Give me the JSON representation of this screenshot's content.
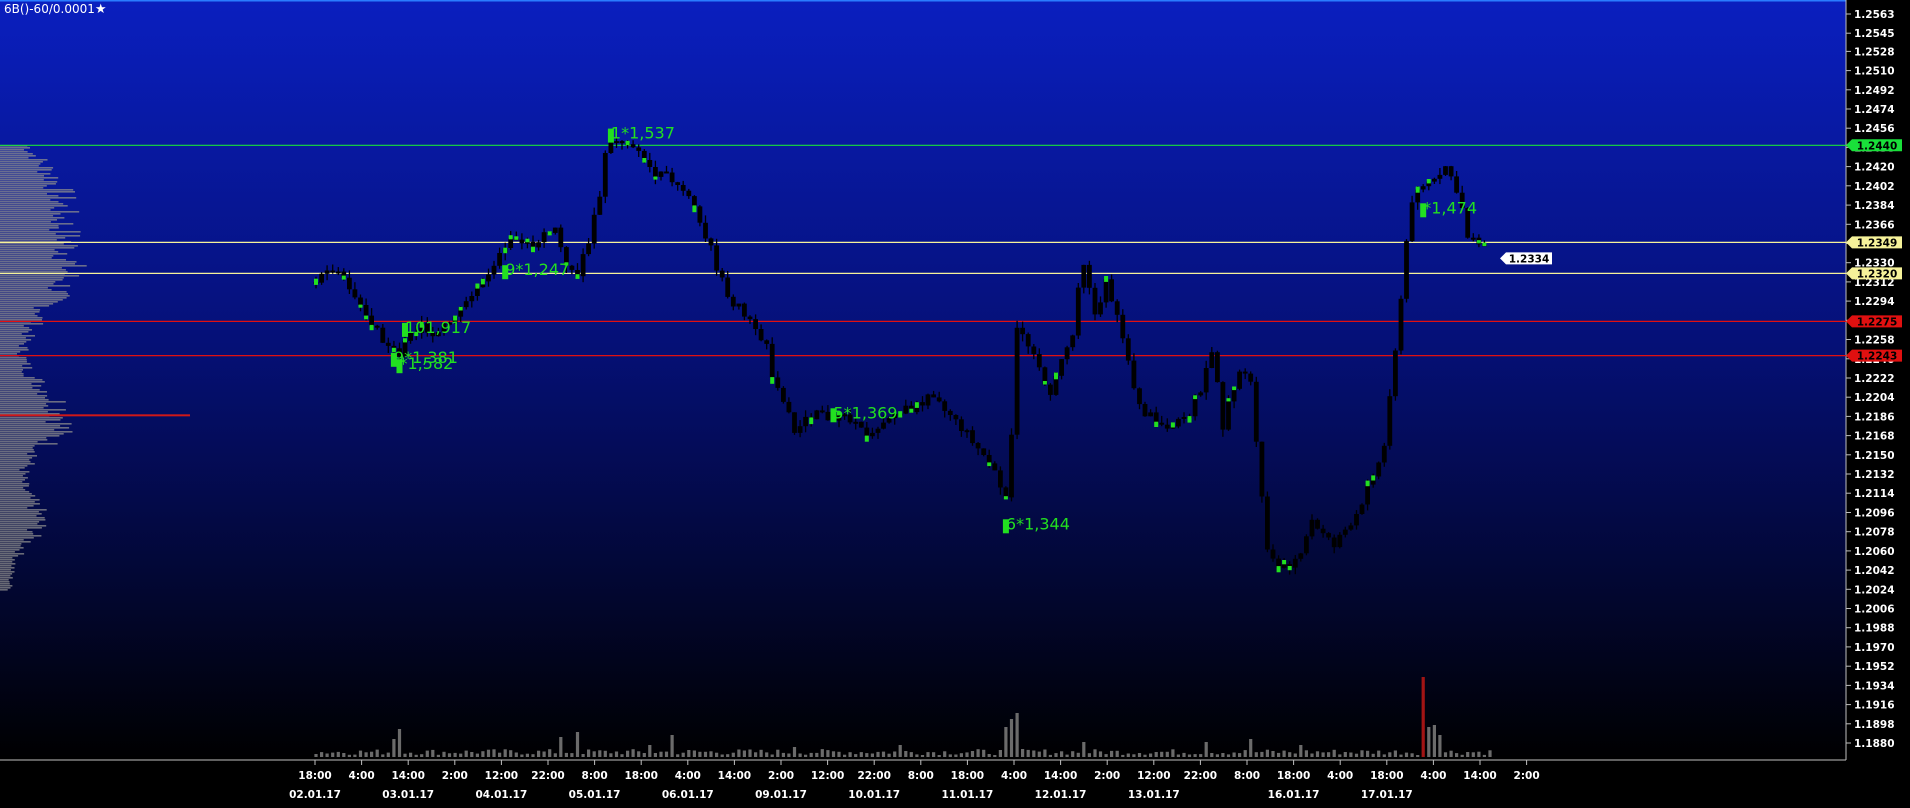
{
  "header": {
    "title": "6B()-60/0.0001",
    "star_icon": "star-icon"
  },
  "colors": {
    "bg_top": "#0a1fbf",
    "bg_bottom": "#000000",
    "candle": "#000000",
    "cluster": "#22e020",
    "profile": "#8c8c8c",
    "poc": "#d01818",
    "volume": "#6b6b6b",
    "volume_peak": "#a11414",
    "level_green": "#19e03a",
    "level_yellow": "#f6f29a",
    "level_red": "#e01010",
    "axis_text": "#ffffff"
  },
  "chart_data": {
    "type": "line",
    "title": "6B()-60/0.0001",
    "ylim": [
      1.187,
      1.257
    ],
    "yticks": [
      1.188,
      1.1898,
      1.1916,
      1.1934,
      1.1952,
      1.197,
      1.1988,
      1.2006,
      1.2024,
      1.2042,
      1.206,
      1.2078,
      1.2096,
      1.2114,
      1.2132,
      1.215,
      1.2168,
      1.2186,
      1.2204,
      1.2222,
      1.224,
      1.2258,
      1.2276,
      1.2294,
      1.2312,
      1.233,
      1.2348,
      1.2366,
      1.2384,
      1.2402,
      1.242,
      1.2438,
      1.2456,
      1.2474,
      1.2492,
      1.251,
      1.2528,
      1.2545,
      1.2563
    ],
    "x_time_labels": [
      "18:00",
      "4:00",
      "14:00",
      "2:00",
      "12:00",
      "22:00",
      "8:00",
      "18:00",
      "4:00",
      "14:00",
      "2:00",
      "12:00",
      "22:00",
      "8:00",
      "18:00",
      "4:00",
      "14:00",
      "2:00",
      "12:00",
      "22:00",
      "8:00",
      "18:00",
      "4:00",
      "18:00",
      "4:00",
      "14:00",
      "2:00"
    ],
    "x_date_labels": [
      "02.01.17",
      "03.01.17",
      "04.01.17",
      "05.01.17",
      "06.01.17",
      "09.01.17",
      "10.01.17",
      "11.01.17",
      "12.01.17",
      "13.01.17",
      "16.01.17",
      "17.01.17"
    ],
    "series": [
      {
        "values": [
          [
            0,
            1.2312
          ],
          [
            3,
            1.2322
          ],
          [
            5,
            1.232
          ],
          [
            7,
            1.23
          ],
          [
            9,
            1.2278
          ],
          [
            11,
            1.2268
          ],
          [
            13,
            1.225
          ],
          [
            15,
            1.2242
          ],
          [
            17,
            1.2262
          ],
          [
            19,
            1.227
          ],
          [
            21,
            1.2258
          ],
          [
            23,
            1.2268
          ],
          [
            25,
            1.2282
          ],
          [
            27,
            1.2298
          ],
          [
            29,
            1.2308
          ],
          [
            31,
            1.2322
          ],
          [
            33,
            1.2335
          ],
          [
            35,
            1.2348
          ],
          [
            37,
            1.2352
          ],
          [
            39,
            1.2348
          ],
          [
            41,
            1.2358
          ],
          [
            43,
            1.2362
          ],
          [
            45,
            1.233
          ],
          [
            47,
            1.2318
          ],
          [
            49,
            1.2352
          ],
          [
            51,
            1.2395
          ],
          [
            52,
            1.2432
          ],
          [
            53,
            1.2445
          ],
          [
            55,
            1.244
          ],
          [
            57,
            1.2436
          ],
          [
            59,
            1.2425
          ],
          [
            61,
            1.2415
          ],
          [
            63,
            1.241
          ],
          [
            65,
            1.2405
          ],
          [
            67,
            1.2395
          ],
          [
            69,
            1.2368
          ],
          [
            71,
            1.2342
          ],
          [
            73,
            1.2312
          ],
          [
            75,
            1.2292
          ],
          [
            77,
            1.2282
          ],
          [
            79,
            1.2272
          ],
          [
            81,
            1.2252
          ],
          [
            82,
            1.2218
          ],
          [
            84,
            1.22
          ],
          [
            86,
            1.2172
          ],
          [
            88,
            1.2182
          ],
          [
            90,
            1.219
          ],
          [
            92,
            1.2185
          ],
          [
            94,
            1.2186
          ],
          [
            96,
            1.218
          ],
          [
            98,
            1.2172
          ],
          [
            100,
            1.2168
          ],
          [
            102,
            1.2176
          ],
          [
            104,
            1.2188
          ],
          [
            106,
            1.2192
          ],
          [
            108,
            1.2195
          ],
          [
            110,
            1.2202
          ],
          [
            112,
            1.2196
          ],
          [
            114,
            1.2186
          ],
          [
            116,
            1.2176
          ],
          [
            118,
            1.2162
          ],
          [
            120,
            1.215
          ],
          [
            122,
            1.2132
          ],
          [
            124,
            1.2114
          ],
          [
            125,
            1.2172
          ],
          [
            126,
            1.2272
          ],
          [
            128,
            1.225
          ],
          [
            130,
            1.223
          ],
          [
            132,
            1.221
          ],
          [
            134,
            1.2238
          ],
          [
            136,
            1.2262
          ],
          [
            137,
            1.2302
          ],
          [
            138,
            1.2325
          ],
          [
            140,
            1.2282
          ],
          [
            142,
            1.2312
          ],
          [
            144,
            1.2285
          ],
          [
            145,
            1.2258
          ],
          [
            147,
            1.221
          ],
          [
            149,
            1.219
          ],
          [
            151,
            1.2182
          ],
          [
            153,
            1.2178
          ],
          [
            155,
            1.2185
          ],
          [
            157,
            1.219
          ],
          [
            159,
            1.2212
          ],
          [
            161,
            1.2242
          ],
          [
            162,
            1.2215
          ],
          [
            163,
            1.2172
          ],
          [
            164,
            1.2205
          ],
          [
            166,
            1.2228
          ],
          [
            168,
            1.222
          ],
          [
            171,
            1.206
          ],
          [
            173,
            1.2048
          ],
          [
            175,
            1.204
          ],
          [
            177,
            1.2062
          ],
          [
            179,
            1.209
          ],
          [
            181,
            1.2075
          ],
          [
            183,
            1.2064
          ],
          [
            185,
            1.208
          ],
          [
            187,
            1.2096
          ],
          [
            189,
            1.2118
          ],
          [
            191,
            1.2142
          ],
          [
            192,
            1.216
          ],
          [
            193,
            1.22
          ],
          [
            194,
            1.2245
          ],
          [
            195,
            1.23
          ],
          [
            196,
            1.235
          ],
          [
            197,
            1.239
          ],
          [
            199,
            1.2398
          ],
          [
            201,
            1.2412
          ],
          [
            203,
            1.242
          ],
          [
            205,
            1.24
          ],
          [
            206,
            1.238
          ],
          [
            207,
            1.2352
          ],
          [
            209,
            1.2348
          ],
          [
            211,
            1.234
          ]
        ]
      }
    ],
    "level_lines": [
      {
        "value": 1.244,
        "label": "1.2440",
        "color": "green"
      },
      {
        "value": 1.2349,
        "label": "1.2349",
        "color": "yellow"
      },
      {
        "value": 1.232,
        "label": "1.2320",
        "color": "yellow"
      },
      {
        "value": 1.2275,
        "label": "1.2275",
        "color": "red"
      },
      {
        "value": 1.2243,
        "label": "1.2243",
        "color": "red"
      }
    ],
    "current_price": {
      "value": 1.2334,
      "label": "1.2334"
    },
    "annotations": [
      {
        "text": "1*1,537",
        "x": 53,
        "y": 1.245
      },
      {
        "text": "9*1,247",
        "x": 34,
        "y": 1.2322
      },
      {
        "text": "101,917",
        "x": 16,
        "y": 1.2268
      },
      {
        "text": "9*1,381",
        "x": 14,
        "y": 1.224
      },
      {
        "text": "*1,582",
        "x": 15,
        "y": 1.2234
      },
      {
        "text": "5*1,369",
        "x": 93,
        "y": 1.2188
      },
      {
        "text": "6*1,344",
        "x": 124,
        "y": 1.2084
      },
      {
        "text": "*1,474",
        "x": 199,
        "y": 1.238
      }
    ]
  }
}
